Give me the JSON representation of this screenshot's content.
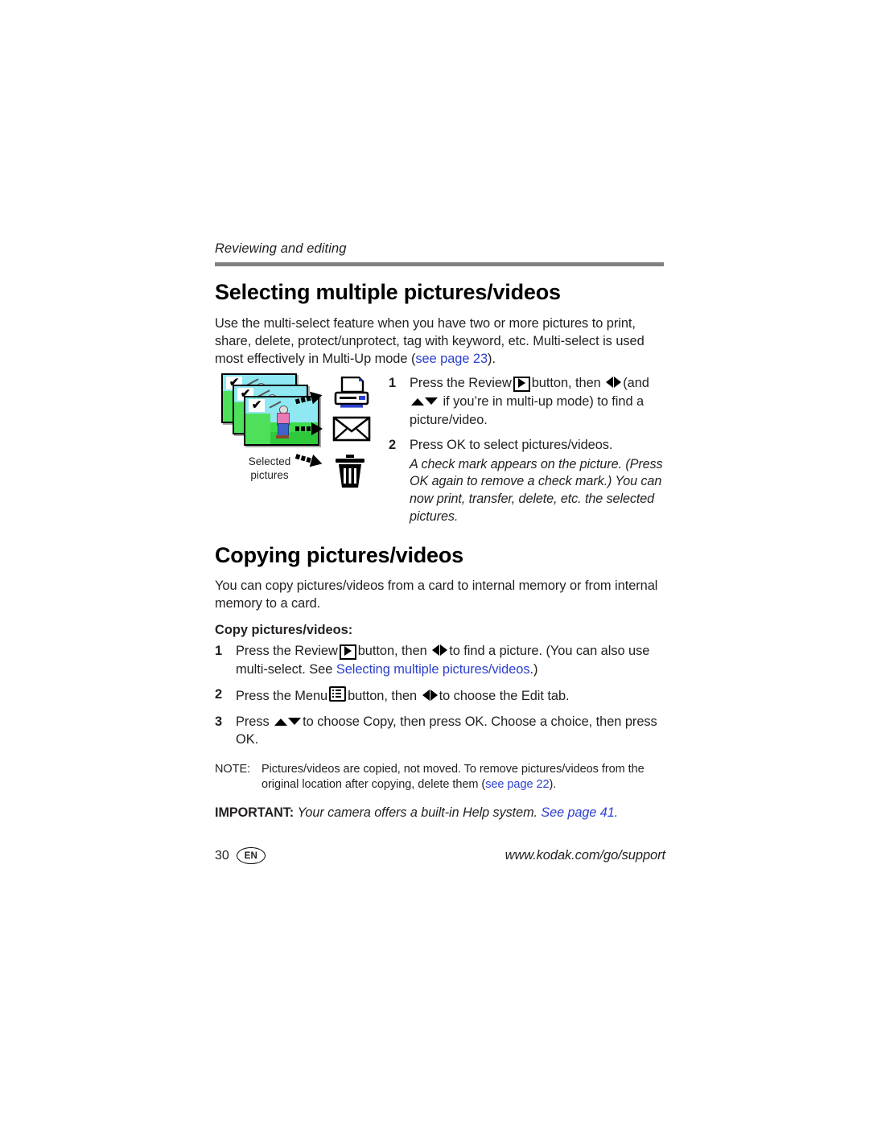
{
  "page": {
    "running_head": "Reviewing and editing",
    "page_number": "30",
    "language_badge": "EN",
    "support_url": "www.kodak.com/go/support"
  },
  "section1": {
    "heading": "Selecting multiple pictures/videos",
    "intro_part1": "Use the multi-select feature when you have two or more pictures to print, share, delete, protect/unprotect, tag with keyword, etc. Multi-select is used most effectively in Multi-Up mode (",
    "intro_link": "see page 23",
    "intro_part2": ").",
    "figure": {
      "caption_line1": "Selected",
      "caption_line2": "pictures",
      "thumbnail_check": "✔",
      "destinations": [
        "printer-icon",
        "envelope-icon",
        "trash-icon"
      ],
      "arrow_icon": "dashed-arrow-icon"
    },
    "steps": [
      {
        "num": "1",
        "part1": "Press the Review",
        "key": "review-play-button",
        "part2": "button, then",
        "arrows1": "left-right-arrows",
        "part3": "(and",
        "arrows2": "up-down-arrows",
        "part4": "if you’re in multi-up mode) to find a picture/video."
      },
      {
        "num": "2",
        "text": "Press OK to select pictures/videos."
      }
    ],
    "step2_note": "A check mark appears on the picture. (Press OK again to remove a check mark.) You can now print, transfer, delete, etc. the selected pictures."
  },
  "section2": {
    "heading": "Copying pictures/videos",
    "intro": "You can copy pictures/videos from a card to internal memory or from internal memory to a card.",
    "subheading": "Copy pictures/videos:",
    "steps": [
      {
        "num": "1",
        "part1": "Press the Review",
        "key": "review-play-button",
        "part2": "button, then",
        "arrows": "left-right-arrows",
        "part3": "to find a picture. (You can also use multi-select. See",
        "link": "Selecting multiple pictures/videos",
        "part4": ".)"
      },
      {
        "num": "2",
        "part1": "Press the Menu",
        "key": "menu-button",
        "part2": "button, then",
        "arrows": "left-right-arrows",
        "part3": "to choose the Edit tab."
      },
      {
        "num": "3",
        "part1": "Press",
        "arrows": "up-down-arrows",
        "part2": "to choose Copy, then press OK. Choose a choice, then press OK."
      }
    ],
    "note": {
      "label": "NOTE:",
      "part1": "Pictures/videos are copied, not moved. To remove pictures/videos from the original location after copying, delete them (",
      "link": "see page 22",
      "part2": ")."
    },
    "important": {
      "label": "IMPORTANT:",
      "text": "Your camera offers a built-in Help system.",
      "link": "See page 41."
    }
  },
  "colors": {
    "link": "#2b3fd0",
    "rule": "#808080",
    "text": "#231f20",
    "printer_accent": "#2b3fd0",
    "thumb_sky": "#8fe8f2",
    "thumb_grass": "#3ddd4a"
  }
}
